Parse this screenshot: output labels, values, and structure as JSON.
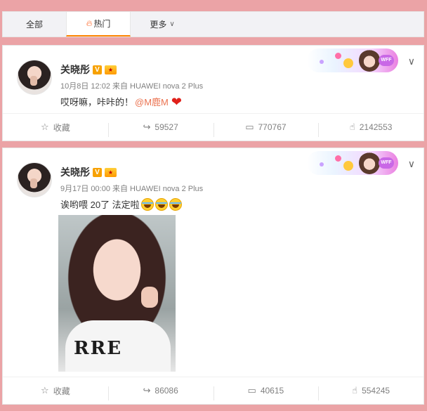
{
  "tabs": [
    {
      "label": "全部"
    },
    {
      "label": "热门"
    },
    {
      "label": "更多"
    }
  ],
  "posts": [
    {
      "author": "关晓彤",
      "verified_badge": "V",
      "meta": "10月8日 12:02 来自 HUAWEI nova 2 Plus",
      "text": "哎呀嘛，咔咔的！",
      "mention": "@M鹿M",
      "emoji": "heart",
      "actions": {
        "favorite": "收藏",
        "repost": "59527",
        "comment": "770767",
        "like": "2142553"
      }
    },
    {
      "author": "关晓彤",
      "verified_badge": "V",
      "meta": "9月17日 00:00 来自 HUAWEI nova 2 Plus",
      "text": "诶哟喂 20了 法定啦",
      "emoji": "laugh-cry x3",
      "actions": {
        "favorite": "收藏",
        "repost": "86086",
        "comment": "40615",
        "like": "554245"
      }
    }
  ],
  "deco_badge": "WFF",
  "colors": {
    "background": "#eba3a6",
    "accent": "#ff8200",
    "mention": "#eb7350",
    "meta": "#808080"
  }
}
